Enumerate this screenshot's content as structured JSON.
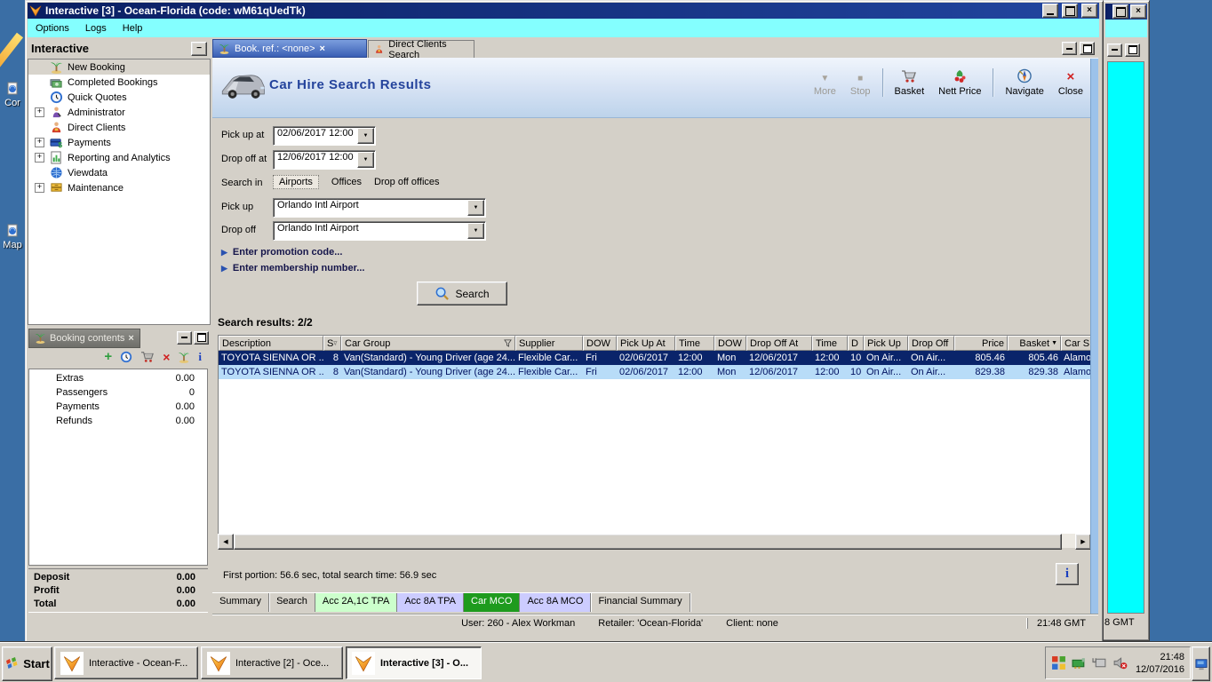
{
  "desktop": {
    "icons": [
      {
        "label": "Cor"
      },
      {
        "label": "Map"
      }
    ]
  },
  "window": {
    "title": "Interactive [3] - Ocean-Florida (code: wM61qUedTk)",
    "menu": [
      "Options",
      "Logs",
      "Help"
    ]
  },
  "sidebar": {
    "title": "Interactive",
    "items": [
      {
        "label": "New Booking",
        "icon": "palm-tree-icon"
      },
      {
        "label": "Completed Bookings",
        "icon": "money-icon"
      },
      {
        "label": "Quick Quotes",
        "icon": "clock-icon"
      },
      {
        "label": "Administrator",
        "icon": "person-icon"
      },
      {
        "label": "Direct Clients",
        "icon": "clients-icon"
      },
      {
        "label": "Payments",
        "icon": "payment-card-icon"
      },
      {
        "label": "Reporting and Analytics",
        "icon": "report-chart-icon"
      },
      {
        "label": "Viewdata",
        "icon": "globe-icon"
      },
      {
        "label": "Maintenance",
        "icon": "drawers-icon"
      }
    ]
  },
  "booking_panel": {
    "tab_label": "Booking contents",
    "rows": [
      {
        "label": "Extras",
        "value": "0.00"
      },
      {
        "label": "Passengers",
        "value": "0"
      },
      {
        "label": "Payments",
        "value": "0.00"
      },
      {
        "label": "Refunds",
        "value": "0.00"
      }
    ],
    "totals": [
      {
        "label": "Deposit",
        "value": "0.00"
      },
      {
        "label": "Profit",
        "value": "0.00"
      },
      {
        "label": "Total",
        "value": "0.00"
      }
    ]
  },
  "main": {
    "tabs": [
      {
        "label": "Book. ref.: <none>"
      },
      {
        "label": "Direct Clients Search"
      }
    ],
    "title": "Car Hire Search Results",
    "toolbar": {
      "more": "More",
      "stop": "Stop",
      "basket": "Basket",
      "nett_price": "Nett Price",
      "navigate": "Navigate",
      "close": "Close"
    },
    "form": {
      "pick_up_at": {
        "label": "Pick up at",
        "value": "02/06/2017 12:00"
      },
      "drop_off_at": {
        "label": "Drop off at",
        "value": "12/06/2017 12:00"
      },
      "search_in": {
        "label": "Search in",
        "options": [
          "Airports",
          "Offices",
          "Drop off offices"
        ],
        "selected": "Airports"
      },
      "pick_up": {
        "label": "Pick up",
        "value": "Orlando Intl Airport"
      },
      "drop_off": {
        "label": "Drop off",
        "value": "Orlando Intl Airport"
      },
      "promotion_link": "Enter promotion code...",
      "membership_link": "Enter membership number...",
      "search_button": "Search"
    },
    "results": {
      "count_label": "Search results: 2/2",
      "columns": [
        "Description",
        "S",
        "Car Group",
        "Supplier",
        "DOW",
        "Pick Up At",
        "Time",
        "DOW",
        "Drop Off At",
        "Time",
        "D",
        "Pick Up",
        "Drop Off",
        "Price",
        "Basket",
        "Car S"
      ],
      "rows": [
        [
          "TOYOTA SIENNA OR ...",
          "8",
          "Van(Standard) - Young Driver (age 24...",
          "Flexible Car...",
          "Fri",
          "02/06/2017",
          "12:00",
          "Mon",
          "12/06/2017",
          "12:00",
          "10",
          "On Air...",
          "On Air...",
          "805.46",
          "805.46",
          "Alamo"
        ],
        [
          "TOYOTA SIENNA OR ...",
          "8",
          "Van(Standard) - Young Driver (age 24...",
          "Flexible Car...",
          "Fri",
          "02/06/2017",
          "12:00",
          "Mon",
          "12/06/2017",
          "12:00",
          "10",
          "On Air...",
          "On Air...",
          "829.38",
          "829.38",
          "Alamo"
        ]
      ],
      "timing": "First portion: 56.6 sec, total search time: 56.9 sec"
    },
    "bottom_tabs": [
      {
        "label": "Summary",
        "style": ""
      },
      {
        "label": "Search",
        "style": ""
      },
      {
        "label": "Acc 2A,1C TPA",
        "style": "background:#ccffcc"
      },
      {
        "label": "Acc 8A TPA",
        "style": "background:#ccccff"
      },
      {
        "label": "Car MCO",
        "style": "background:#1e9b1e;color:#ffffff"
      },
      {
        "label": "Acc 8A MCO",
        "style": "background:#ccccff"
      },
      {
        "label": "Financial Summary",
        "style": ""
      }
    ]
  },
  "statusbar": {
    "user": "User: 260 - Alex Workman",
    "retailer": "Retailer: 'Ocean-Florida'",
    "client": "Client: none",
    "time": "21:48 GMT"
  },
  "background_window": {
    "status_fragment": "8 GMT"
  },
  "taskbar": {
    "start_label": "Start",
    "buttons": [
      {
        "label": "Interactive - Ocean-F..."
      },
      {
        "label": "Interactive [2] - Oce..."
      },
      {
        "label": "Interactive [3] - O..."
      }
    ],
    "clock": {
      "time": "21:48",
      "date": "12/07/2016"
    }
  },
  "icons": {
    "close": "×",
    "collapse": "−",
    "expand": "+",
    "dropdown": "▼",
    "left": "◀",
    "right": "▶",
    "sort_desc": "▼",
    "link_arrow": "▶",
    "info": "i",
    "more": "▼",
    "stop": "■",
    "plus": "+",
    "delete": "×",
    "nett": "$"
  },
  "colors": {
    "desktop": "#3a6ea5",
    "titlebar": "#0a246a",
    "menubar": "#84ffff",
    "selected_row": "#0a246a",
    "alt_row": "#b8dcf8",
    "active_tab": "#3a5fb4",
    "tab_green": "#ccffcc",
    "tab_lavender": "#ccccff",
    "tab_dark_green": "#1e9b1e"
  }
}
